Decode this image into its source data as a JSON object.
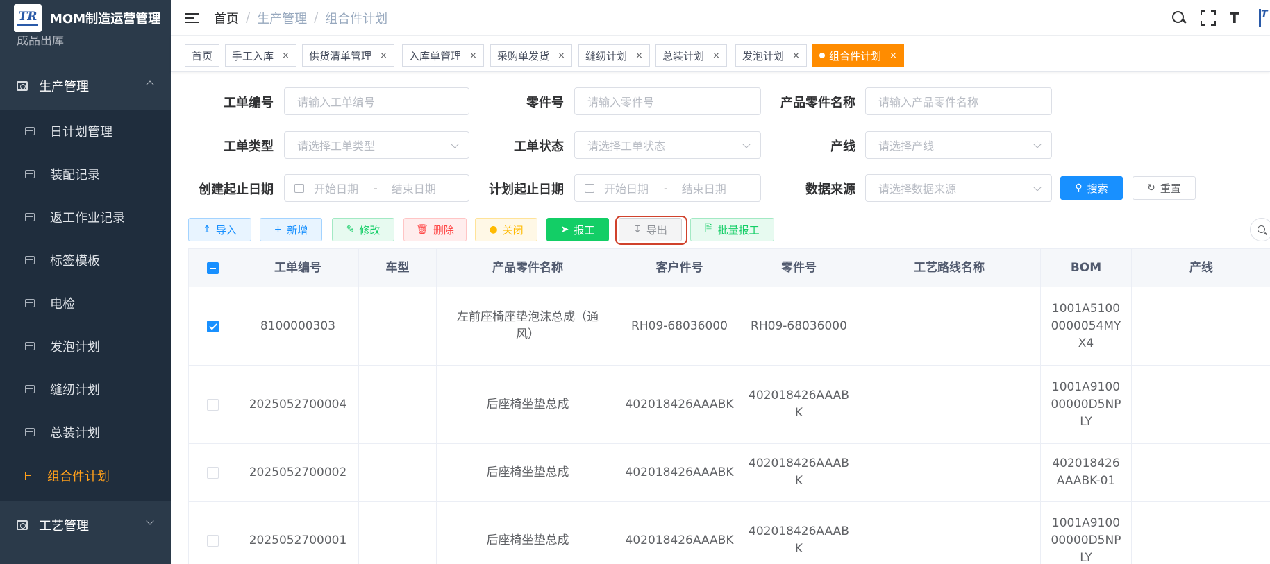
{
  "app": {
    "title": "MOM制造运营管理",
    "logo_text": "TR"
  },
  "sidebar": {
    "ghost_item": "成品出库",
    "group_production": "生产管理",
    "items": [
      {
        "label": "日计划管理"
      },
      {
        "label": "装配记录"
      },
      {
        "label": "返工作业记录"
      },
      {
        "label": "标签模板"
      },
      {
        "label": "电检"
      },
      {
        "label": "发泡计划"
      },
      {
        "label": "缝纫计划"
      },
      {
        "label": "总装计划"
      },
      {
        "label": "组合件计划",
        "active": true
      }
    ],
    "group_process": "工艺管理"
  },
  "header": {
    "breadcrumb": [
      "首页",
      "生产管理",
      "组合件计划"
    ],
    "size_icon_glyph": "T",
    "avatar_text": "T"
  },
  "tags": [
    {
      "label": "首页",
      "closable": false
    },
    {
      "label": "手工入库",
      "closable": true
    },
    {
      "label": "供货清单管理",
      "closable": true
    },
    {
      "label": "入库单管理",
      "closable": true
    },
    {
      "label": "采购单发货",
      "closable": true
    },
    {
      "label": "缝纫计划",
      "closable": true
    },
    {
      "label": "总装计划",
      "closable": true
    },
    {
      "label": "发泡计划",
      "closable": true
    },
    {
      "label": "组合件计划",
      "closable": true,
      "active": true
    }
  ],
  "tag_close_glyph": "×",
  "filters": {
    "work_order_no": {
      "label": "工单编号",
      "placeholder": "请输入工单编号"
    },
    "part_no": {
      "label": "零件号",
      "placeholder": "请输入零件号"
    },
    "product_part_name": {
      "label": "产品零件名称",
      "placeholder": "请输入产品零件名称"
    },
    "work_order_type": {
      "label": "工单类型",
      "placeholder": "请选择工单类型"
    },
    "work_order_status": {
      "label": "工单状态",
      "placeholder": "请选择工单状态"
    },
    "line": {
      "label": "产线",
      "placeholder": "请选择产线"
    },
    "create_date": {
      "label": "创建起止日期",
      "start": "开始日期",
      "end": "结束日期"
    },
    "plan_date": {
      "label": "计划起止日期",
      "start": "开始日期",
      "end": "结束日期"
    },
    "data_source": {
      "label": "数据来源",
      "placeholder": "请选择数据来源"
    },
    "date_separator": "-",
    "search_label": "搜索",
    "reset_label": "重置"
  },
  "toolbar": {
    "import": "导入",
    "add": "新增",
    "edit": "修改",
    "delete": "删除",
    "close": "关闭",
    "report": "报工",
    "export": "导出",
    "batch_report": "批量报工"
  },
  "table": {
    "columns": [
      "工单编号",
      "车型",
      "产品零件名称",
      "客户件号",
      "零件号",
      "工艺路线名称",
      "BOM",
      "产线"
    ],
    "rows": [
      {
        "checked": true,
        "work_order_no": "8100000303",
        "model": "",
        "product_name": "左前座椅座垫泡沫总成（通风）",
        "customer_part_no": "RH09-68036000",
        "part_no": "RH09-68036000",
        "route": "",
        "bom": "1001A51000000054MYX4",
        "line": ""
      },
      {
        "checked": false,
        "work_order_no": "2025052700004",
        "model": "",
        "product_name": "后座椅坐垫总成",
        "customer_part_no": "402018426AAABK",
        "part_no": "402018426AAABK",
        "route": "",
        "bom": "1001A910000000D5NPLY",
        "line": ""
      },
      {
        "checked": false,
        "work_order_no": "2025052700002",
        "model": "",
        "product_name": "后座椅坐垫总成",
        "customer_part_no": "402018426AAABK",
        "part_no": "402018426AAABK",
        "route": "",
        "bom": "402018426AAABK-01",
        "line": ""
      },
      {
        "checked": false,
        "work_order_no": "2025052700001",
        "model": "",
        "product_name": "后座椅坐垫总成",
        "customer_part_no": "402018426AAABK",
        "part_no": "402018426AAABK",
        "route": "",
        "bom": "1001A910000000D5NPLY",
        "line": ""
      }
    ]
  },
  "colors": {
    "sidebar_bg": "#2b3a4a",
    "submenu_bg": "#1f2d3d",
    "active_orange": "#ff8c00",
    "primary_blue": "#1890ff",
    "success_green": "#13ce66",
    "danger_red": "#ff4949",
    "warning_yellow": "#ffba00",
    "highlight_red": "#d0422c"
  }
}
